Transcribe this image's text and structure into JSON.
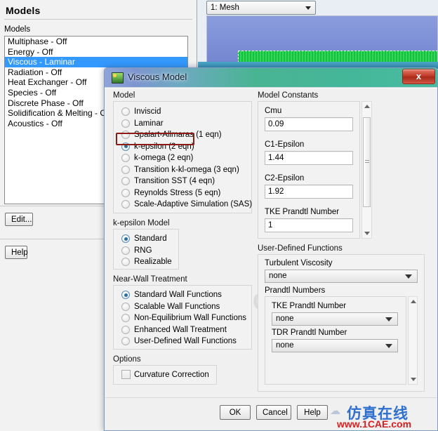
{
  "background": {
    "panel_title": "Models",
    "models_label": "Models",
    "models_list": [
      {
        "label": "Multiphase - Off",
        "selected": false
      },
      {
        "label": "Energy - Off",
        "selected": false
      },
      {
        "label": "Viscous - Laminar",
        "selected": true
      },
      {
        "label": "Radiation - Off",
        "selected": false
      },
      {
        "label": "Heat Exchanger - Off",
        "selected": false
      },
      {
        "label": "Species - Off",
        "selected": false
      },
      {
        "label": "Discrete Phase - Off",
        "selected": false
      },
      {
        "label": "Solidification & Melting - Off",
        "selected": false
      },
      {
        "label": "Acoustics - Off",
        "selected": false
      }
    ],
    "edit_button": "Edit...",
    "help_button": "Help",
    "mesh_combo_value": "1: Mesh"
  },
  "dialog": {
    "title": "Viscous Model",
    "close_label": "x",
    "model_group_label": "Model",
    "model_options": [
      {
        "label": "Inviscid",
        "selected": false
      },
      {
        "label": "Laminar",
        "selected": false
      },
      {
        "label": "Spalart-Allmaras (1 eqn)",
        "selected": false
      },
      {
        "label": "k-epsilon (2 eqn)",
        "selected": true
      },
      {
        "label": "k-omega (2 eqn)",
        "selected": false
      },
      {
        "label": "Transition k-kl-omega (3 eqn)",
        "selected": false
      },
      {
        "label": "Transition SST (4 eqn)",
        "selected": false
      },
      {
        "label": "Reynolds Stress (5 eqn)",
        "selected": false
      },
      {
        "label": "Scale-Adaptive Simulation (SAS)",
        "selected": false
      }
    ],
    "ke_group_label": "k-epsilon Model",
    "ke_options": [
      {
        "label": "Standard",
        "selected": true
      },
      {
        "label": "RNG",
        "selected": false
      },
      {
        "label": "Realizable",
        "selected": false
      }
    ],
    "nearwall_group_label": "Near-Wall Treatment",
    "nearwall_options": [
      {
        "label": "Standard Wall Functions",
        "selected": true
      },
      {
        "label": "Scalable Wall Functions",
        "selected": false
      },
      {
        "label": "Non-Equilibrium Wall Functions",
        "selected": false
      },
      {
        "label": "Enhanced Wall Treatment",
        "selected": false
      },
      {
        "label": "User-Defined Wall Functions",
        "selected": false
      }
    ],
    "options_group_label": "Options",
    "options_items": [
      {
        "label": "Curvature Correction",
        "checked": false
      }
    ],
    "constants_group_label": "Model Constants",
    "constants": [
      {
        "label": "Cmu",
        "value": "0.09"
      },
      {
        "label": "C1-Epsilon",
        "value": "1.44"
      },
      {
        "label": "C2-Epsilon",
        "value": "1.92"
      },
      {
        "label": "TKE Prandtl Number",
        "value": "1"
      }
    ],
    "udf_group_label": "User-Defined Functions",
    "udf_turbvisc_label": "Turbulent Viscosity",
    "udf_turbvisc_value": "none",
    "udf_prandtl_group_label": "Prandtl Numbers",
    "udf_prandtl": [
      {
        "label": "TKE Prandtl Number",
        "value": "none"
      },
      {
        "label": "TDR Prandtl Number",
        "value": "none"
      }
    ],
    "ok_label": "OK",
    "cancel_label": "Cancel",
    "help_label": "Help",
    "highlight_color": "#8c1b16"
  },
  "watermarks": {
    "center": "1CAE.COM",
    "corner_cn": "仿真在线",
    "corner_url": "www.1CAE.com"
  }
}
